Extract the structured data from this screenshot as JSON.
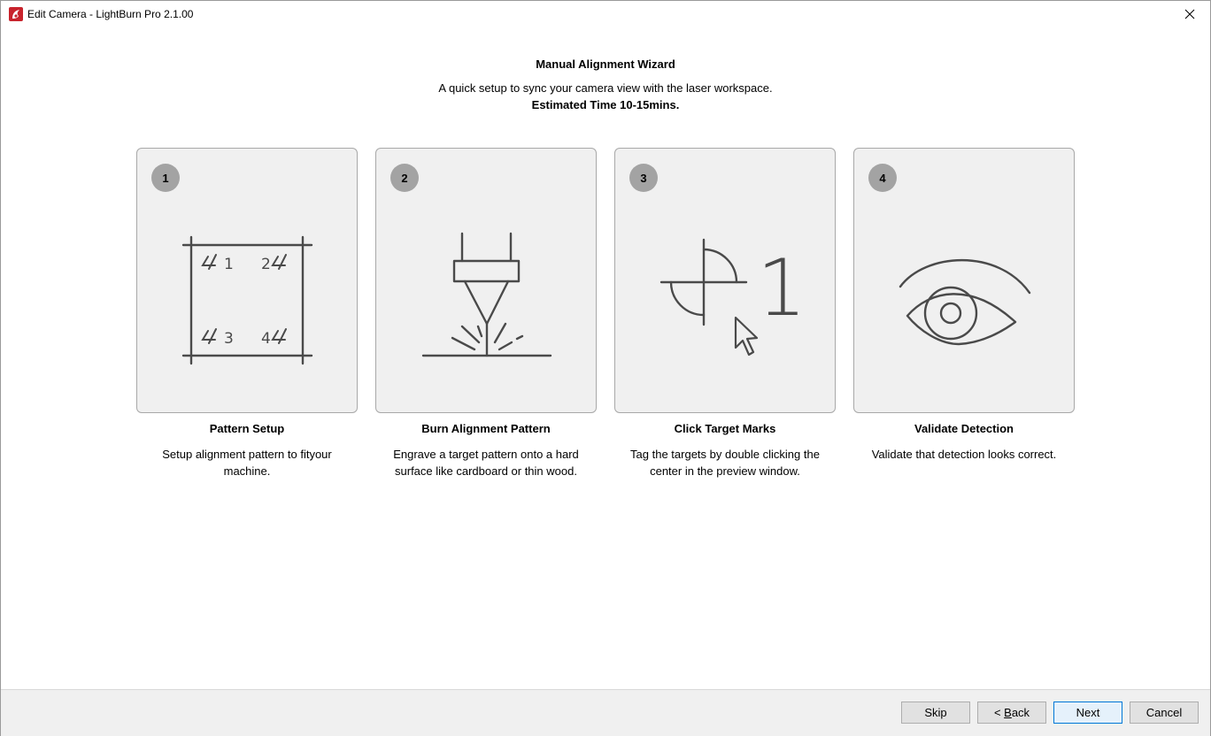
{
  "window": {
    "title": "Edit Camera - LightBurn Pro 2.1.00"
  },
  "wizard": {
    "title": "Manual Alignment Wizard",
    "subtitle": "A quick setup to sync your camera view with the laser workspace.",
    "estimate": "Estimated Time 10-15mins."
  },
  "steps": [
    {
      "number": "1",
      "title": "Pattern Setup",
      "description": "Setup alignment pattern to fityour machine.",
      "icon": "alignment-pattern-icon"
    },
    {
      "number": "2",
      "title": "Burn Alignment Pattern",
      "description": "Engrave a target pattern onto a hard surface like cardboard or thin wood.",
      "icon": "laser-head-icon"
    },
    {
      "number": "3",
      "title": "Click Target Marks",
      "description": "Tag the targets by double clicking the center in the preview window.",
      "icon": "target-cursor-icon"
    },
    {
      "number": "4",
      "title": "Validate Detection",
      "description": "Validate that detection looks correct.",
      "icon": "eye-icon"
    }
  ],
  "pattern_labels": [
    "1",
    "2",
    "3",
    "4"
  ],
  "target_label": "1",
  "buttons": {
    "skip": "Skip",
    "back_prefix": "< ",
    "back_mnemonic": "B",
    "back_rest": "ack",
    "next": "Next",
    "cancel": "Cancel"
  },
  "colors": {
    "accent": "#0078d7",
    "badge": "#a3a3a3",
    "card_bg": "#f0f0f0",
    "icon_stroke": "#4a4a4a"
  }
}
